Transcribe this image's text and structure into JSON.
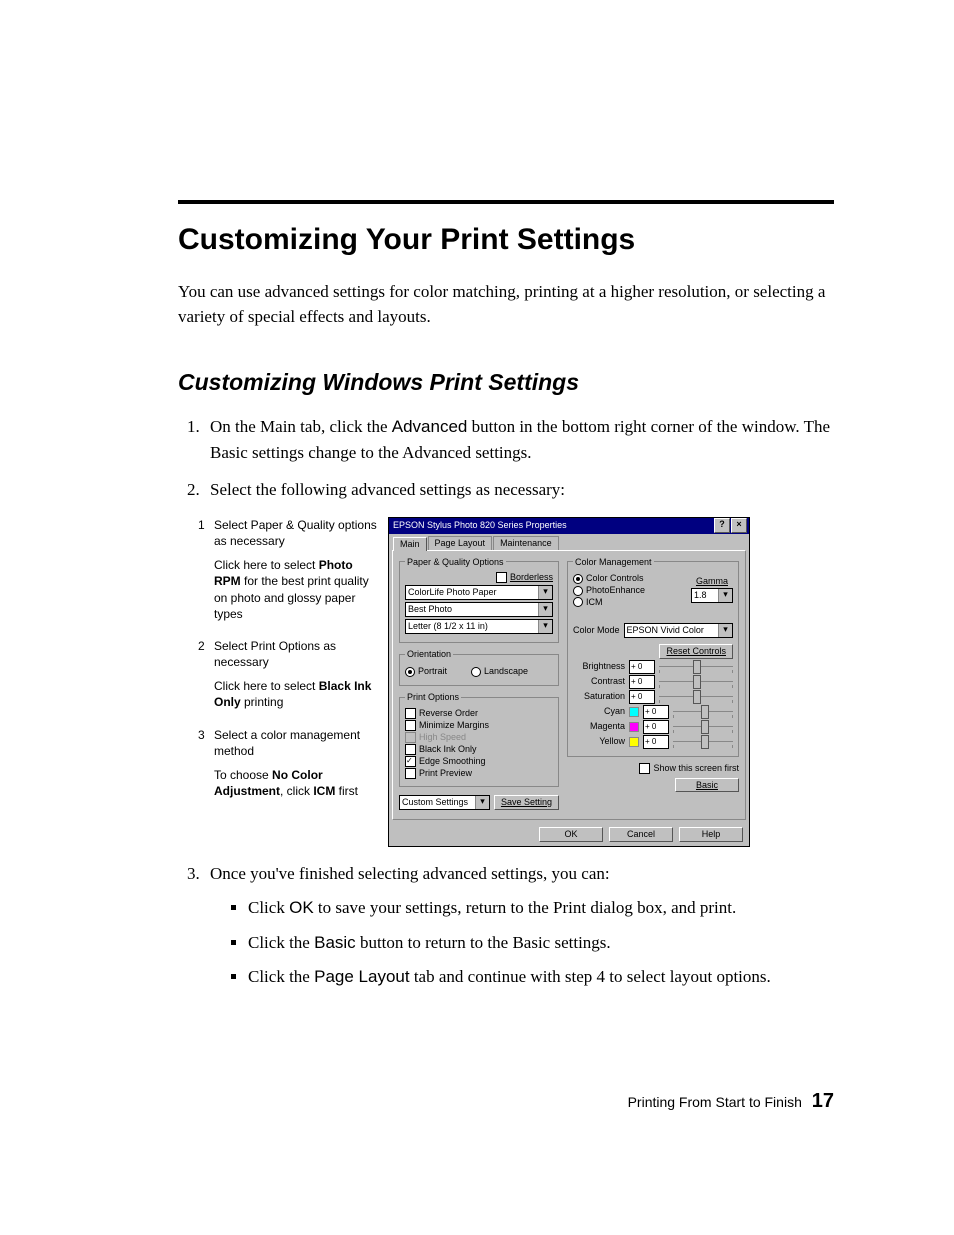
{
  "heading": "Customizing Your Print Settings",
  "intro": "You can use advanced settings for color matching, printing at a higher resolution, or selecting a variety of special effects and layouts.",
  "subheading": "Customizing Windows Print Settings",
  "step1_a": "On the Main tab, click the ",
  "step1_b": "Advanced",
  "step1_c": " button in the bottom right corner of the window. The Basic settings change to the Advanced settings.",
  "step2": "Select the following advanced settings as necessary:",
  "step3": "Once you've finished selecting advanced settings, you can:",
  "b1_a": "Click ",
  "b1_b": "OK",
  "b1_c": " to save your settings, return to the Print dialog box, and print.",
  "b2_a": "Click the ",
  "b2_b": "Basic",
  "b2_c": " button to return to the Basic settings.",
  "b3_a": "Click the ",
  "b3_b": "Page Layout",
  "b3_c": " tab and continue with step 4 to select layout options.",
  "callouts": {
    "c1_num": "1",
    "c1": "Select Paper & Quality options as necessary",
    "c1n_a": "Click here to select ",
    "c1n_b": "Photo RPM",
    "c1n_c": " for the best print quality on photo and glossy paper types",
    "c2_num": "2",
    "c2": "Select Print Options as necessary",
    "c2n_a": "Click here to select ",
    "c2n_b": "Black Ink Only",
    "c2n_c": " printing",
    "c3_num": "3",
    "c3": "Select a color management method",
    "c3n_a": "To choose ",
    "c3n_b": "No Color Adjustment",
    "c3n_c": ", click ",
    "c3n_d": "ICM",
    "c3n_e": " first"
  },
  "dialog": {
    "title": "EPSON Stylus Photo 820 Series Properties",
    "tabs": {
      "main": "Main",
      "layout": "Page Layout",
      "maint": "Maintenance"
    },
    "pq": {
      "legend": "Paper & Quality Options",
      "borderless": "Borderless",
      "paper": "ColorLife Photo Paper",
      "quality": "Best Photo",
      "size": "Letter (8 1/2 x 11 in)"
    },
    "orient": {
      "legend": "Orientation",
      "portrait": "Portrait",
      "landscape": "Landscape"
    },
    "po": {
      "legend": "Print Options",
      "reverse": "Reverse Order",
      "minmargin": "Minimize Margins",
      "highspeed": "High Speed",
      "blackink": "Black Ink Only",
      "edge": "Edge Smoothing",
      "preview": "Print Preview"
    },
    "custom": "Custom Settings",
    "save": "Save Setting",
    "cm": {
      "legend": "Color Management",
      "cc": "Color Controls",
      "pe": "PhotoEnhance",
      "icm": "ICM",
      "gamma_lbl": "Gamma",
      "gamma": "1.8",
      "mode_lbl": "Color Mode",
      "mode": "EPSON Vivid Color",
      "reset": "Reset Controls",
      "brightness": "Brightness",
      "contrast": "Contrast",
      "saturation": "Saturation",
      "cyan": "Cyan",
      "magenta": "Magenta",
      "yellow": "Yellow",
      "zero": "+ 0"
    },
    "showfirst": "Show this screen first",
    "basic": "Basic",
    "ok": "OK",
    "cancel": "Cancel",
    "help": "Help"
  },
  "footer": {
    "text": "Printing From Start to Finish",
    "page": "17"
  }
}
